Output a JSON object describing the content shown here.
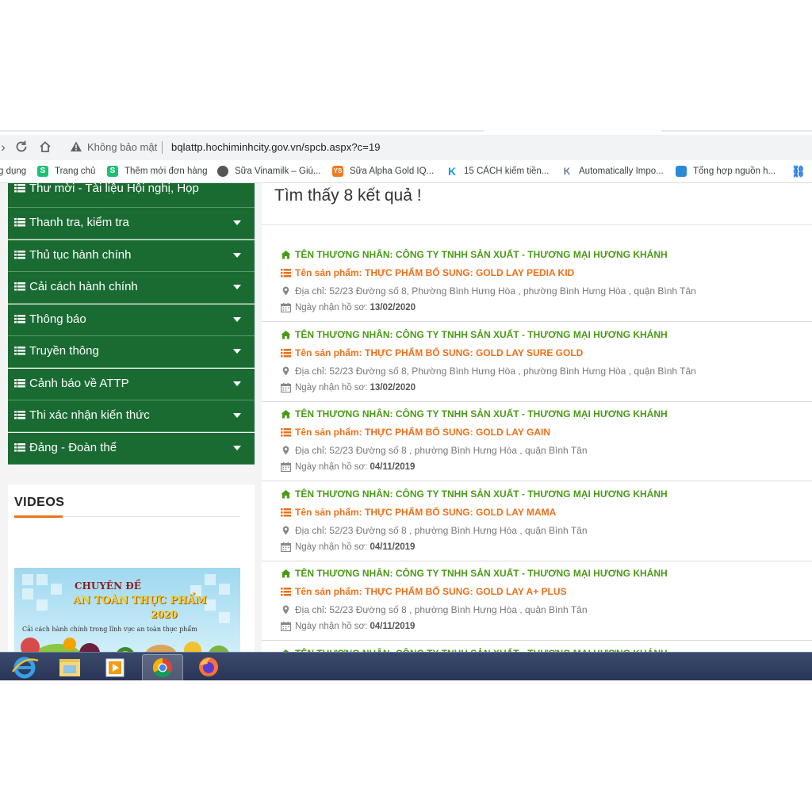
{
  "browser": {
    "security_label": "Không bảo mật",
    "url": "bqlattp.hochiminhcity.gov.vn/spcb.aspx?c=19"
  },
  "bookmarks": [
    {
      "label": "g dụng",
      "icon": "apps-icon",
      "color": ""
    },
    {
      "label": "Trang chủ",
      "icon": "s-logo-icon",
      "color": "#1cbf73"
    },
    {
      "label": "Thêm mới đơn hàng",
      "icon": "s-logo-icon",
      "color": "#1cbf73"
    },
    {
      "label": "Sữa Vinamilk – Giú...",
      "icon": "globe-icon",
      "color": "#555555"
    },
    {
      "label": "Sữa Alpha Gold IQ...",
      "icon": "ys-logo-icon",
      "color": "#f07b1e"
    },
    {
      "label": "15 CÁCH kiếm tiền...",
      "icon": "k-logo-icon",
      "color": "#1a9be0"
    },
    {
      "label": "Automatically Impo...",
      "icon": "kr-logo-icon",
      "color": "#6b7fa8"
    },
    {
      "label": "Tổng hợp nguồn h...",
      "icon": "bookmark-blue-icon",
      "color": "#2a8ad8"
    }
  ],
  "sidebar": {
    "menu": [
      {
        "label": "Thư mời - Tài liệu Hội nghị, Họp",
        "has_caret": false
      },
      {
        "label": "Thanh tra, kiểm tra",
        "has_caret": true
      },
      {
        "label": "Thủ tục hành chính",
        "has_caret": true
      },
      {
        "label": "Cải cách hành chính",
        "has_caret": true
      },
      {
        "label": "Thông báo",
        "has_caret": true
      },
      {
        "label": "Truyền thông",
        "has_caret": true
      },
      {
        "label": "Cảnh báo về ATTP",
        "has_caret": true
      },
      {
        "label": "Thi xác nhận kiến thức",
        "has_caret": true
      },
      {
        "label": "Đảng - Đoàn thể",
        "has_caret": true
      }
    ],
    "videos": {
      "title": "VIDEOS",
      "thumbnail": {
        "line1": "CHUYÊN ĐỀ",
        "line2": "AN TOÀN THỰC PHẨM",
        "line3": "2020",
        "line4": "Cải cách hành chính trong lĩnh vực an toàn thực phẩm"
      }
    }
  },
  "content": {
    "result_text": "Tìm thấy 8 kết quả !",
    "records": [
      {
        "merchant": "TÊN THƯƠNG NHÂN: CÔNG TY TNHH SẢN XUẤT - THƯƠNG MẠI HƯƠNG KHÁNH",
        "product": "Tên sản phẩm: THỰC PHẨM BỔ SUNG: GOLD LAY PEDIA KID",
        "address": "Địa chỉ: 52/23 Đường số 8, Phường Bình Hưng Hòa , phường Bình Hưng Hòa , quận Bình Tân",
        "date_label": "Ngày nhận hồ sơ:",
        "date": "13/02/2020"
      },
      {
        "merchant": "TÊN THƯƠNG NHÂN: CÔNG TY TNHH SẢN XUẤT - THƯƠNG MẠI HƯƠNG KHÁNH",
        "product": "Tên sản phẩm: THỰC PHẨM BỔ SUNG: GOLD LAY SURE GOLD",
        "address": "Địa chỉ: 52/23 Đường số 8, Phường Bình Hưng Hòa , phường Bình Hưng Hòa , quận Bình Tân",
        "date_label": "Ngày nhận hồ sơ:",
        "date": "13/02/2020"
      },
      {
        "merchant": "TÊN THƯƠNG NHÂN: CÔNG TY TNHH SẢN XUẤT - THƯƠNG MẠI HƯƠNG KHÁNH",
        "product": "Tên sản phẩm: THỰC PHẨM BỔ SUNG: GOLD LAY GAIN",
        "address": "Địa chỉ: 52/23 Đường số 8 , phường Bình Hưng Hòa , quận Bình Tân",
        "date_label": "Ngày nhận hồ sơ:",
        "date": "04/11/2019"
      },
      {
        "merchant": "TÊN THƯƠNG NHÂN: CÔNG TY TNHH SẢN XUẤT - THƯƠNG MẠI HƯƠNG KHÁNH",
        "product": "Tên sản phẩm: THỰC PHẨM BỔ SUNG: GOLD LAY MAMA",
        "address": "Địa chỉ: 52/23 Đường số 8 , phường Bình Hưng Hòa , quận Bình Tân",
        "date_label": "Ngày nhận hồ sơ:",
        "date": "04/11/2019"
      },
      {
        "merchant": "TÊN THƯƠNG NHÂN: CÔNG TY TNHH SẢN XUẤT - THƯƠNG MẠI HƯƠNG KHÁNH",
        "product": "Tên sản phẩm: THỰC PHẨM BỔ SUNG: GOLD LAY A+ PLUS",
        "address": "Địa chỉ: 52/23 Đường số 8 , phường Bình Hưng Hòa , quận Bình Tân",
        "date_label": "Ngày nhận hồ sơ:",
        "date": "04/11/2019"
      },
      {
        "merchant": "TÊN THƯƠNG NHÂN: CÔNG TY TNHH SẢN XUẤT - THƯƠNG MẠI HƯƠNG KHÁNH",
        "product": "",
        "address": "",
        "date_label": "",
        "date": ""
      }
    ]
  },
  "taskbar": {
    "apps": [
      "internet-explorer-icon",
      "file-explorer-icon",
      "media-player-icon",
      "chrome-icon",
      "firefox-icon"
    ],
    "active_app": "chrome-icon"
  },
  "colors": {
    "menu_green": "#1a6b32",
    "merchant_green": "#4a9a17",
    "product_orange": "#ee6f1a",
    "accent_orange": "#e8731e"
  }
}
